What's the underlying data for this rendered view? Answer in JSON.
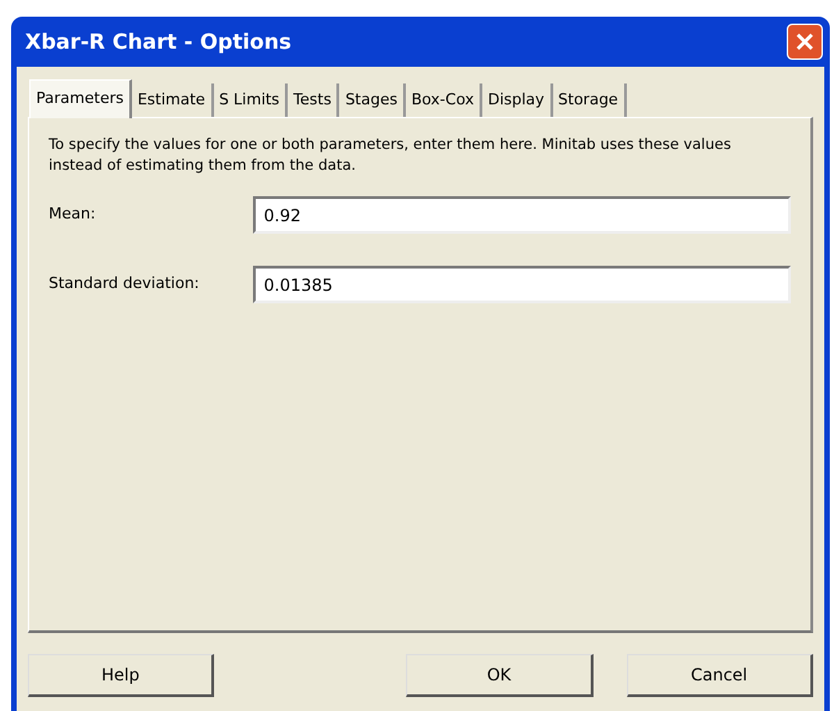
{
  "window": {
    "title": "Xbar-R Chart - Options"
  },
  "tabs": [
    {
      "label": "Parameters",
      "selected": true
    },
    {
      "label": "Estimate",
      "selected": false
    },
    {
      "label": "S Limits",
      "selected": false
    },
    {
      "label": "Tests",
      "selected": false
    },
    {
      "label": "Stages",
      "selected": false
    },
    {
      "label": "Box-Cox",
      "selected": false
    },
    {
      "label": "Display",
      "selected": false
    },
    {
      "label": "Storage",
      "selected": false
    }
  ],
  "instructions": "To specify the values for one or both parameters, enter them here.  Minitab uses these values instead of estimating them from the data.",
  "fields": [
    {
      "label": "Mean:",
      "value": "0.92"
    },
    {
      "label": "Standard deviation:",
      "value": "0.01385"
    }
  ],
  "buttons": [
    {
      "label": "Help"
    },
    {
      "label": "OK"
    },
    {
      "label": "Cancel"
    }
  ]
}
